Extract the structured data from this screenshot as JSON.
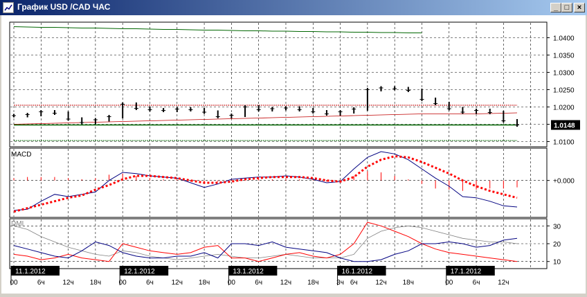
{
  "window": {
    "title": "График USD /CAD  ЧАС",
    "buttons": {
      "minimize": "_",
      "maximize": "□",
      "close": "×"
    }
  },
  "colors": {
    "price_bars": "#000000",
    "resistance_line": "#c00000",
    "support_line": "#006600",
    "macd_line": "#000080",
    "signal_line": "#ff0000",
    "histogram": "#ff0000",
    "dmi_plus": "#000080",
    "dmi_minus": "#ff0000",
    "adx": "#808080"
  },
  "chart_data": [
    {
      "type": "line",
      "panel": "price",
      "symbol": "USD/CAD",
      "timeframe": "ЧАС",
      "ylim": [
        1.0085,
        1.0445
      ],
      "y_ticks": [
        "1.0400",
        "1.0350",
        "1.0300",
        "1.0250",
        "1.0200",
        "1.0150",
        "1.0100"
      ],
      "current_price_label": "1.0148",
      "grid": true,
      "x": [
        0,
        3,
        6,
        9,
        12,
        15,
        18,
        21,
        24,
        27,
        30,
        33,
        36,
        39,
        42,
        45,
        48,
        51,
        54,
        57,
        60,
        63,
        66,
        69,
        72,
        75,
        78,
        81,
        84,
        87,
        90,
        93,
        96,
        99,
        102,
        105,
        108,
        111
      ],
      "series": [
        {
          "values": [
            1.0175,
            1.0178,
            1.0186,
            1.0182,
            1.0165,
            1.0155,
            1.0163,
            1.0172,
            1.0208,
            1.0196,
            1.0192,
            1.019,
            1.0194,
            1.0192,
            1.0185,
            1.0172,
            1.0176,
            1.02,
            1.0192,
            1.0195,
            1.0197,
            1.0192,
            1.0186,
            1.018,
            1.0186,
            1.0194,
            1.025,
            1.0255,
            1.0253,
            1.0248,
            1.0222,
            1.021,
            1.0195,
            1.0185,
            1.019,
            1.0184,
            1.016,
            1.0148
          ]
        },
        {
          "name": "resistance",
          "values": [
            1.0205,
            1.0205,
            1.0205,
            1.0205,
            1.0205,
            1.0205,
            1.0205,
            1.0205,
            1.0205,
            1.0205,
            1.0205,
            1.0205,
            1.0205,
            1.0205,
            1.0205,
            1.0205,
            1.0205,
            1.0205,
            1.0205,
            1.0205,
            1.0205,
            1.0205,
            1.0205,
            1.0205,
            1.0205,
            1.0205,
            1.0205,
            1.0205,
            1.0205,
            1.0205,
            1.0205,
            1.0205,
            1.0205,
            1.0205,
            1.0205,
            1.0205,
            1.0205,
            1.0205
          ]
        },
        {
          "name": "trend",
          "values": [
            1.015,
            1.0151,
            1.0152,
            1.0153,
            1.0154,
            1.0155,
            1.0156,
            1.0157,
            1.0158,
            1.0159,
            1.016,
            1.0161,
            1.0162,
            1.0163,
            1.0164,
            1.0165,
            1.0166,
            1.0167,
            1.0168,
            1.0169,
            1.017,
            1.0171,
            1.0172,
            1.0173,
            1.0174,
            1.0175,
            1.0176,
            1.0177,
            1.0178,
            1.0179,
            1.018,
            1.018,
            1.018,
            1.018,
            1.018,
            1.0181,
            1.0182,
            1.0183
          ]
        },
        {
          "name": "support",
          "values": [
            1.0148,
            1.0148,
            1.0148,
            1.0148,
            1.0148,
            1.0148,
            1.0148,
            1.0148,
            1.0148,
            1.0148,
            1.0148,
            1.0148,
            1.0148,
            1.0148,
            1.0148,
            1.0148,
            1.0148,
            1.0148,
            1.0148,
            1.0148,
            1.0148,
            1.0148,
            1.0148,
            1.0148,
            1.0148,
            1.0148,
            1.0148,
            1.0148,
            1.0148,
            1.0148,
            1.0148,
            1.0148,
            1.0148,
            1.0148,
            1.0148,
            1.0148,
            1.0148,
            1.0148
          ]
        },
        {
          "name": "lower-band",
          "values": [
            1.0103,
            1.0103,
            1.0103,
            1.0103,
            1.0103,
            1.0103,
            1.0103,
            1.0103,
            1.0103,
            1.0103,
            1.0103,
            1.0103,
            1.0103,
            1.0103,
            1.0103,
            1.0103,
            1.0103,
            1.0103,
            1.0103,
            1.0103,
            1.0103,
            1.0103,
            1.0103,
            1.0103,
            1.0103,
            1.0103,
            1.0103,
            1.0103,
            1.0103,
            1.0103,
            1.0103,
            1.0103,
            1.0103,
            1.0103,
            1.0103,
            1.0103,
            1.0103,
            1.0103
          ]
        },
        {
          "name": "upper-band",
          "x_range": [
            0,
            90
          ],
          "values": [
            1.0432,
            1.0431,
            1.043,
            1.043,
            1.0429,
            1.0428,
            1.0428,
            1.0427,
            1.0426,
            1.0426,
            1.0425,
            1.0424,
            1.0424,
            1.0423,
            1.0422,
            1.0422,
            1.0421,
            1.042,
            1.042,
            1.0419,
            1.0419,
            1.0418,
            1.0418,
            1.0417,
            1.0417,
            1.0416,
            1.0416,
            1.0415,
            1.0415,
            1.0414,
            1.0414
          ]
        }
      ]
    },
    {
      "type": "line",
      "panel": "MACD",
      "title": "MACD",
      "ylim": [
        -0.0032,
        0.0028
      ],
      "y_ticks": [
        "+0.000"
      ],
      "grid": true,
      "x": [
        0,
        3,
        6,
        9,
        12,
        15,
        18,
        21,
        24,
        27,
        30,
        33,
        36,
        39,
        42,
        45,
        48,
        51,
        54,
        57,
        60,
        63,
        66,
        69,
        72,
        75,
        78,
        81,
        84,
        87,
        90,
        93,
        96,
        99,
        102,
        105,
        108,
        111
      ],
      "series": [
        {
          "values": [
            -0.0026,
            -0.0025,
            -0.0018,
            -0.0012,
            -0.0014,
            -0.0012,
            -0.001,
            0.0,
            0.0007,
            0.0006,
            0.0004,
            0.0003,
            0.0002,
            -0.0002,
            -0.0006,
            -0.0003,
            0.0001,
            0.0002,
            0.0003,
            0.0003,
            0.0004,
            0.0003,
            0.0001,
            -0.0002,
            -0.0001,
            0.001,
            0.002,
            0.0025,
            0.0023,
            0.0018,
            0.001,
            0.0002,
            -0.0005,
            -0.0014,
            -0.0015,
            -0.0018,
            -0.0022,
            -0.0023
          ]
        },
        {
          "values": [
            -0.0027,
            -0.0024,
            -0.0021,
            -0.0018,
            -0.0015,
            -0.0013,
            -0.0008,
            -0.0004,
            0.0001,
            0.0004,
            0.0004,
            0.0003,
            0.0002,
            0.0,
            -0.0002,
            -0.0002,
            -0.0001,
            0.0001,
            0.0002,
            0.0003,
            0.0003,
            0.0003,
            0.0002,
            0.0,
            -0.0001,
            0.0003,
            0.0012,
            0.0018,
            0.0021,
            0.002,
            0.0016,
            0.0011,
            0.0006,
            0.0,
            -0.0005,
            -0.0009,
            -0.0012,
            -0.0015
          ]
        },
        {
          "values": [
            0.0002,
            0.0003,
            0.0003,
            0.0003,
            0.0002,
            0.0001,
            0.0002,
            0.0005,
            0.0006,
            0.0004,
            0.0002,
            0.0001,
            0.0001,
            -0.0001,
            -0.0002,
            -0.0001,
            0.0001,
            0.0002,
            0.0002,
            0.0001,
            0.0001,
            0.0001,
            0.0001,
            -0.0001,
            -0.0002,
            0.0004,
            0.0008,
            0.0007,
            0.0004,
            0.0001,
            -0.0003,
            -0.0007,
            -0.0008,
            -0.0009,
            -0.0008,
            -0.0007,
            -0.0007,
            -0.0006
          ]
        }
      ]
    },
    {
      "type": "line",
      "panel": "DMI",
      "title": "DMI",
      "ylim": [
        6,
        34
      ],
      "y_ticks": [
        "30",
        "20",
        "10"
      ],
      "grid": true,
      "x": [
        0,
        3,
        6,
        9,
        12,
        15,
        18,
        21,
        24,
        27,
        30,
        33,
        36,
        39,
        42,
        45,
        48,
        51,
        54,
        57,
        60,
        63,
        66,
        69,
        72,
        75,
        78,
        81,
        84,
        87,
        90,
        93,
        96,
        99,
        102,
        105,
        108,
        111
      ],
      "series": [
        {
          "values": [
            19,
            17,
            15,
            13,
            12,
            16,
            21,
            19,
            15,
            13,
            12,
            12,
            13,
            13,
            15,
            12,
            20,
            20,
            19,
            21,
            18,
            17,
            16,
            15,
            12,
            10,
            10,
            11,
            14,
            16,
            20,
            20,
            21,
            20,
            18,
            19,
            22,
            23
          ]
        },
        {
          "values": [
            14,
            13,
            11,
            12,
            14,
            12,
            11,
            10,
            20,
            18,
            16,
            15,
            14,
            15,
            18,
            19,
            12,
            12,
            10,
            12,
            14,
            15,
            13,
            12,
            14,
            20,
            32,
            30,
            27,
            24,
            20,
            17,
            15,
            14,
            13,
            12,
            11,
            10
          ]
        },
        {
          "values": [
            30,
            28,
            24,
            21,
            18,
            16,
            14,
            13,
            16,
            15,
            13,
            12,
            11,
            12,
            13,
            14,
            13,
            12,
            12,
            13,
            14,
            13,
            12,
            12,
            12,
            14,
            23,
            27,
            29,
            30,
            29,
            27,
            25,
            23,
            22,
            21,
            21,
            20
          ]
        }
      ]
    }
  ],
  "time_axis": {
    "date_labels": [
      {
        "text": "11.1.2012",
        "x": 0
      },
      {
        "text": "12.1.2012",
        "x": 24
      },
      {
        "text": "13.1.2012",
        "x": 48
      },
      {
        "text": "16.1.2012",
        "x": 72
      },
      {
        "text": "17.1.2012",
        "x": 96
      }
    ],
    "hour_labels": [
      {
        "text": "00",
        "x": 0
      },
      {
        "text": "6ч",
        "x": 6
      },
      {
        "text": "12ч",
        "x": 12
      },
      {
        "text": "18ч",
        "x": 18
      },
      {
        "text": "00",
        "x": 24
      },
      {
        "text": "6ч",
        "x": 30
      },
      {
        "text": "12ч",
        "x": 36
      },
      {
        "text": "18ч",
        "x": 42
      },
      {
        "text": "00",
        "x": 48
      },
      {
        "text": "6ч",
        "x": 54
      },
      {
        "text": "12ч",
        "x": 60
      },
      {
        "text": "18ч",
        "x": 66
      },
      {
        "text": "3ч",
        "x": 72
      },
      {
        "text": "6ч",
        "x": 75
      },
      {
        "text": "12ч",
        "x": 81
      },
      {
        "text": "18ч",
        "x": 87
      },
      {
        "text": "00",
        "x": 96
      },
      {
        "text": "6ч",
        "x": 102
      },
      {
        "text": "12ч",
        "x": 108
      }
    ]
  }
}
